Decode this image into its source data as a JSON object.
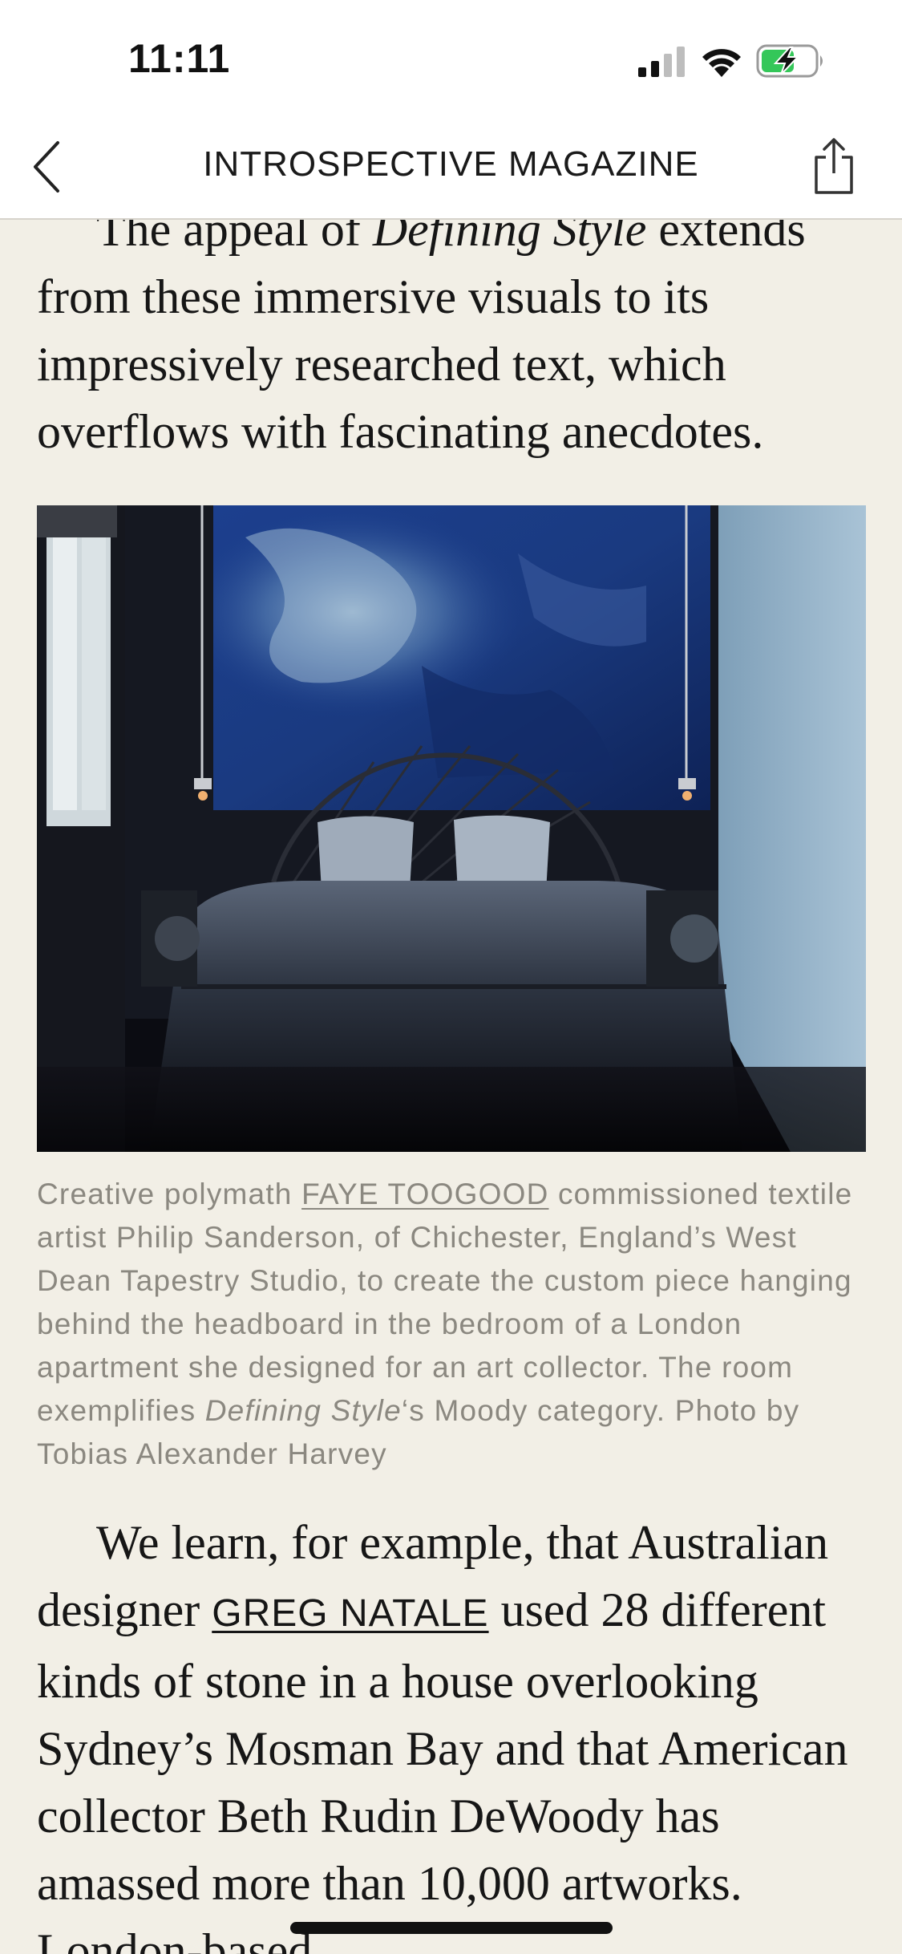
{
  "status_bar": {
    "time": "11:11",
    "signal_icon": "cellular-signal-icon",
    "wifi_icon": "wifi-icon",
    "battery_icon": "battery-charging-icon",
    "battery_color": "#34c759"
  },
  "nav": {
    "back_icon": "chevron-left-icon",
    "title": "INTROSPECTIVE MAGAZINE",
    "share_icon": "share-icon"
  },
  "article": {
    "para1_before": "The appeal of ",
    "para1_italic": "Defining Style",
    "para1_after": " extends from these immersive visuals to its impressively researched text, which overflows with fascinating anecdotes.",
    "photo": {
      "description_icon": "bedroom-photo"
    },
    "caption": {
      "before_link": "Creative polymath ",
      "link": "FAYE TOOGOOD",
      "after_link": " commissioned textile artist Philip Sanderson, of Chichester, England’s West Dean Tapestry Studio, to create the custom piece hanging behind the headboard in the bedroom of a London apartment she designed for an art collector. The room exemplifies ",
      "italic": "Defining Style",
      "after_italic": "‘s Moody category. Photo by Tobias Alexander Harvey"
    },
    "para2_before": "We learn, for example, that Australian designer ",
    "para2_link": "GREG NATALE",
    "para2_after": " used 28 different kinds of stone in a house overlooking Sydney’s Mosman Bay and that American collector Beth Rudin DeWoody has amassed more than 10,000 artworks. London-based"
  },
  "colors": {
    "background": "#f2efe6",
    "caption_text": "#8b8880",
    "body_text": "#161616"
  }
}
